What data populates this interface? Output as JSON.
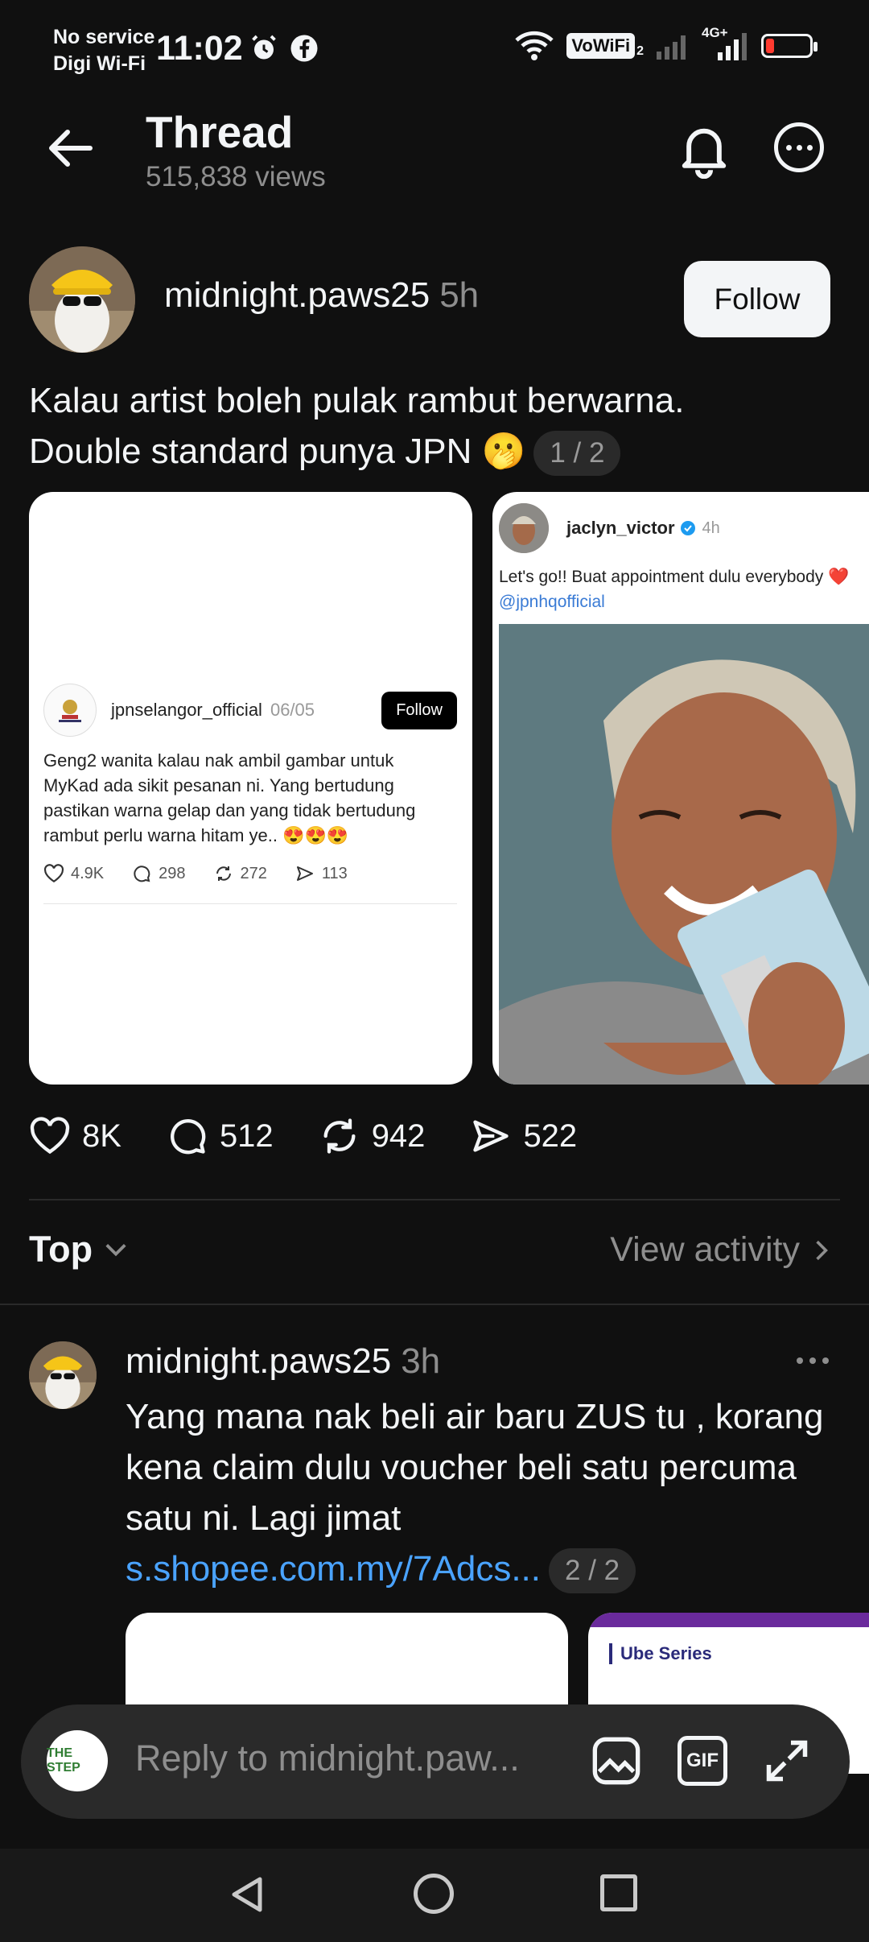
{
  "status_bar": {
    "carrier_line1": "No service",
    "carrier_line2": "Digi Wi-Fi",
    "time": "11:02",
    "vowifi": "VoWiFi",
    "vowifi_sub": "2",
    "network": "4G+",
    "icons": [
      "alarm-icon",
      "facebook-icon",
      "wifi-icon",
      "signal-icon",
      "battery-icon"
    ],
    "battery_color": "#ff3b30"
  },
  "header": {
    "title": "Thread",
    "views": "515,838 views"
  },
  "post": {
    "username": "midnight.paws25",
    "time": "5h",
    "follow_label": "Follow",
    "text_line1": "Kalau artist boleh pulak rambut berwarna.",
    "text_line2": "Double standard punya JPN 🫢",
    "page_indicator": "1 / 2",
    "embed1": {
      "username": "jpnselangor_official",
      "date": "06/05",
      "follow_label": "Follow",
      "text": "Geng2 wanita kalau nak ambil gambar untuk MyKad ada sikit pesanan ni. Yang bertudung pastikan warna gelap dan yang tidak bertudung rambut perlu warna hitam ye.. 😍😍😍",
      "likes": "4.9K",
      "comments": "298",
      "reposts": "272",
      "shares": "113"
    },
    "embed2": {
      "username": "jaclyn_victor",
      "time": "4h",
      "text": "Let's go!! Buat appointment dulu everybody ❤️",
      "mention": "@jpnhqofficial"
    },
    "likes": "8K",
    "comments": "512",
    "reposts": "942",
    "shares": "522"
  },
  "sort": {
    "label": "Top",
    "view_activity": "View activity"
  },
  "reply": {
    "username": "midnight.paws25",
    "time": "3h",
    "text": "Yang mana nak beli air baru ZUS tu , korang kena claim dulu voucher beli satu percuma satu ni. Lagi jimat",
    "link": "s.shopee.com.my/7Adcs...",
    "page_indicator": "2 / 2",
    "card2_title": "Ube Series"
  },
  "composer": {
    "avatar_text": "THE STEP",
    "placeholder": "Reply to midnight.paw..."
  }
}
